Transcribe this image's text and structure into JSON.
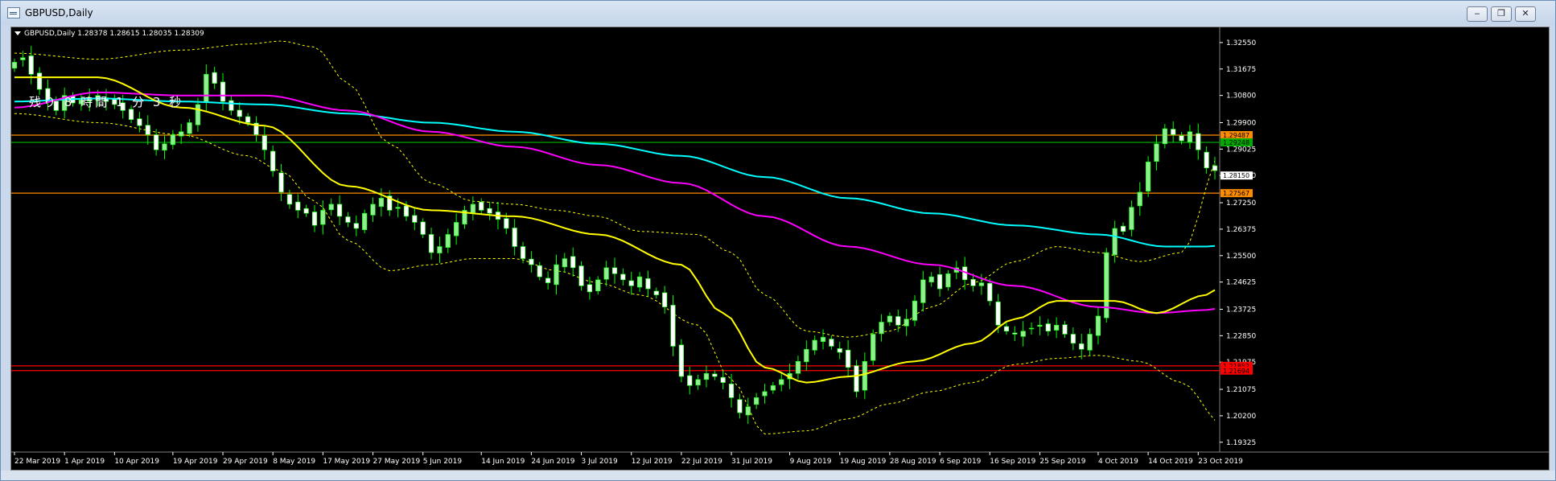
{
  "window": {
    "title": "GBPUSD,Daily",
    "buttons": {
      "minimize": "‒",
      "restore": "❐",
      "close": "✕"
    }
  },
  "chart": {
    "info_line": "GBPUSD,Daily  1.28378 1.28615 1.28035 1.28309",
    "countdown": "残り 8 時間 1 分 3 秒",
    "colors": {
      "background": "#000000",
      "bull_candle": "#90ee90",
      "bear_candle": "#ffffff",
      "wick": "#00ff00",
      "ma_fast": "#ffff00",
      "ma_mid": "#ff00ff",
      "ma_slow": "#00ffff",
      "bands": "#ffff00",
      "level_orange": "#ff8c00",
      "level_green": "#00ff00",
      "level_red": "#ff0000",
      "axis_text": "#ffffff"
    }
  },
  "chart_data": {
    "type": "candlestick",
    "symbol": "GBPUSD",
    "timeframe": "Daily",
    "last_price": "1.28309",
    "ylim": [
      1.19,
      1.33
    ],
    "y_ticks": [
      "1.32550",
      "1.31675",
      "1.30800",
      "1.29900",
      "1.29025",
      "1.28150",
      "1.27250",
      "1.26375",
      "1.25500",
      "1.24625",
      "1.23725",
      "1.22850",
      "1.21975",
      "1.21075",
      "1.20200",
      "1.19325"
    ],
    "x_ticks": [
      "22 Mar 2019",
      "1 Apr 2019",
      "10 Apr 2019",
      "19 Apr 2019",
      "29 Apr 2019",
      "8 May 2019",
      "17 May 2019",
      "27 May 2019",
      "5 Jun 2019",
      "14 Jun 2019",
      "24 Jun 2019",
      "3 Jul 2019",
      "12 Jul 2019",
      "22 Jul 2019",
      "31 Jul 2019",
      "9 Aug 2019",
      "19 Aug 2019",
      "28 Aug 2019",
      "6 Sep 2019",
      "16 Sep 2019",
      "25 Sep 2019",
      "4 Oct 2019",
      "14 Oct 2019",
      "23 Oct 2019"
    ],
    "close_path": [
      1.319,
      1.3205,
      1.315,
      1.31,
      1.306,
      1.303,
      1.308,
      1.3055,
      1.3065,
      1.307,
      1.308,
      1.306,
      1.305,
      1.303,
      1.3,
      1.298,
      1.295,
      1.29,
      1.292,
      1.295,
      1.296,
      1.299,
      1.305,
      1.315,
      1.312,
      1.306,
      1.303,
      1.301,
      1.299,
      1.295,
      1.29,
      1.283,
      1.276,
      1.272,
      1.27,
      1.269,
      1.265,
      1.27,
      1.272,
      1.268,
      1.266,
      1.264,
      1.269,
      1.272,
      1.274,
      1.27,
      1.271,
      1.268,
      1.266,
      1.262,
      1.256,
      1.258,
      1.262,
      1.266,
      1.27,
      1.272,
      1.27,
      1.269,
      1.267,
      1.264,
      1.258,
      1.254,
      1.252,
      1.248,
      1.246,
      1.252,
      1.254,
      1.251,
      1.245,
      1.243,
      1.247,
      1.251,
      1.249,
      1.247,
      1.245,
      1.248,
      1.244,
      1.242,
      1.238,
      1.225,
      1.215,
      1.212,
      1.214,
      1.216,
      1.215,
      1.213,
      1.208,
      1.203,
      1.205,
      1.208,
      1.21,
      1.212,
      1.214,
      1.216,
      1.22,
      1.224,
      1.227,
      1.228,
      1.225,
      1.223,
      1.218,
      1.21,
      1.22,
      1.229,
      1.233,
      1.235,
      1.232,
      1.234,
      1.24,
      1.247,
      1.248,
      1.244,
      1.249,
      1.251,
      1.247,
      1.245,
      1.246,
      1.24,
      1.232,
      1.23,
      1.229,
      1.23,
      1.231,
      1.232,
      1.23,
      1.232,
      1.229,
      1.226,
      1.224,
      1.229,
      1.235,
      1.256,
      1.264,
      1.263,
      1.271,
      1.276,
      1.286,
      1.292,
      1.297,
      1.295,
      1.293,
      1.296,
      1.29,
      1.284,
      1.2831
    ],
    "ma_fast_anchors": [
      [
        0,
        1.314
      ],
      [
        10,
        1.314
      ],
      [
        20,
        1.304
      ],
      [
        30,
        1.298
      ],
      [
        40,
        1.278
      ],
      [
        50,
        1.27
      ],
      [
        60,
        1.268
      ],
      [
        70,
        1.262
      ],
      [
        80,
        1.252
      ],
      [
        85,
        1.236
      ],
      [
        90,
        1.218
      ],
      [
        95,
        1.213
      ],
      [
        100,
        1.215
      ],
      [
        108,
        1.22
      ],
      [
        115,
        1.226
      ],
      [
        120,
        1.234
      ],
      [
        125,
        1.24
      ],
      [
        132,
        1.24
      ],
      [
        137,
        1.236
      ],
      [
        143,
        1.242
      ],
      [
        149,
        1.264
      ]
    ],
    "ma_mid_anchors": [
      [
        0,
        1.304
      ],
      [
        10,
        1.309
      ],
      [
        20,
        1.308
      ],
      [
        30,
        1.308
      ],
      [
        40,
        1.303
      ],
      [
        50,
        1.296
      ],
      [
        60,
        1.291
      ],
      [
        70,
        1.285
      ],
      [
        80,
        1.279
      ],
      [
        90,
        1.268
      ],
      [
        100,
        1.258
      ],
      [
        110,
        1.252
      ],
      [
        120,
        1.245
      ],
      [
        130,
        1.238
      ],
      [
        137,
        1.236
      ],
      [
        143,
        1.237
      ],
      [
        149,
        1.242
      ]
    ],
    "ma_slow_anchors": [
      [
        0,
        1.306
      ],
      [
        10,
        1.307
      ],
      [
        20,
        1.306
      ],
      [
        30,
        1.305
      ],
      [
        40,
        1.302
      ],
      [
        50,
        1.299
      ],
      [
        60,
        1.296
      ],
      [
        70,
        1.292
      ],
      [
        80,
        1.288
      ],
      [
        90,
        1.281
      ],
      [
        100,
        1.274
      ],
      [
        110,
        1.269
      ],
      [
        120,
        1.265
      ],
      [
        130,
        1.262
      ],
      [
        138,
        1.258
      ],
      [
        143,
        1.258
      ],
      [
        149,
        1.261
      ]
    ],
    "band_upper_anchors": [
      [
        0,
        1.322
      ],
      [
        10,
        1.32
      ],
      [
        20,
        1.323
      ],
      [
        28,
        1.325
      ],
      [
        32,
        1.326
      ],
      [
        36,
        1.324
      ],
      [
        40,
        1.312
      ],
      [
        45,
        1.292
      ],
      [
        50,
        1.279
      ],
      [
        55,
        1.273
      ],
      [
        60,
        1.272
      ],
      [
        65,
        1.27
      ],
      [
        70,
        1.268
      ],
      [
        75,
        1.263
      ],
      [
        82,
        1.262
      ],
      [
        86,
        1.256
      ],
      [
        90,
        1.242
      ],
      [
        95,
        1.23
      ],
      [
        100,
        1.228
      ],
      [
        105,
        1.23
      ],
      [
        110,
        1.238
      ],
      [
        115,
        1.246
      ],
      [
        120,
        1.253
      ],
      [
        125,
        1.258
      ],
      [
        130,
        1.256
      ],
      [
        135,
        1.253
      ],
      [
        140,
        1.256
      ],
      [
        145,
        1.29
      ],
      [
        149,
        1.317
      ]
    ],
    "band_lower_anchors": [
      [
        0,
        1.302
      ],
      [
        10,
        1.299
      ],
      [
        20,
        1.295
      ],
      [
        28,
        1.288
      ],
      [
        32,
        1.283
      ],
      [
        36,
        1.273
      ],
      [
        40,
        1.26
      ],
      [
        45,
        1.25
      ],
      [
        50,
        1.252
      ],
      [
        55,
        1.254
      ],
      [
        60,
        1.254
      ],
      [
        65,
        1.25
      ],
      [
        70,
        1.246
      ],
      [
        75,
        1.242
      ],
      [
        82,
        1.232
      ],
      [
        86,
        1.214
      ],
      [
        90,
        1.196
      ],
      [
        95,
        1.197
      ],
      [
        100,
        1.201
      ],
      [
        105,
        1.206
      ],
      [
        110,
        1.21
      ],
      [
        115,
        1.213
      ],
      [
        120,
        1.219
      ],
      [
        125,
        1.221
      ],
      [
        130,
        1.222
      ],
      [
        135,
        1.22
      ],
      [
        140,
        1.213
      ],
      [
        145,
        1.199
      ],
      [
        149,
        1.207
      ]
    ],
    "levels": [
      {
        "price": 1.29487,
        "label": "1.29487",
        "color": "#ff8c00"
      },
      {
        "price": 1.29248,
        "label": "1.29248",
        "color": "#00aa00"
      },
      {
        "price": 1.2815,
        "label": "1.28150",
        "color": "#ffffff"
      },
      {
        "price": 1.27567,
        "label": "1.27567",
        "color": "#ff8c00"
      },
      {
        "price": 1.21852,
        "label": "1.21852",
        "color": "#ff0000"
      },
      {
        "price": 1.21694,
        "label": "1.21694",
        "color": "#ff0000"
      }
    ]
  }
}
